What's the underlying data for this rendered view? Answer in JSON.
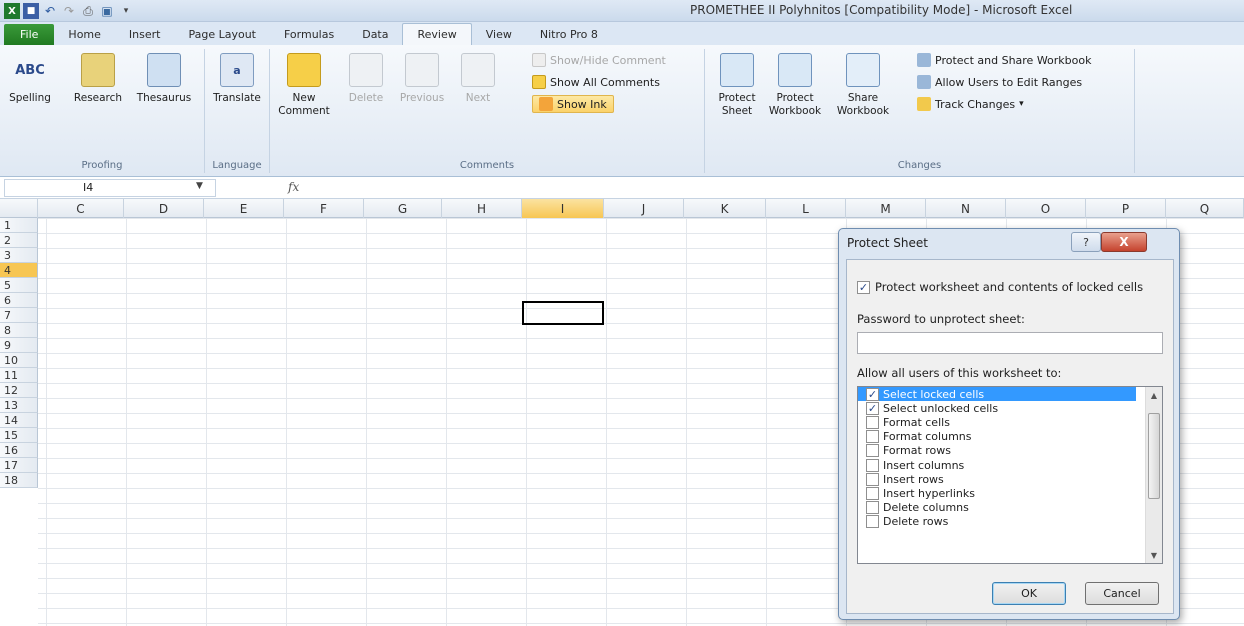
{
  "window": {
    "title": "PROMETHEE II Polyhnitos  [Compatibility Mode]  -  Microsoft Excel"
  },
  "tabs": [
    "File",
    "Home",
    "Insert",
    "Page Layout",
    "Formulas",
    "Data",
    "Review",
    "View",
    "Nitro Pro 8"
  ],
  "active_tab": "Review",
  "ribbon": {
    "proofing": {
      "label": "Proofing",
      "spelling": "Spelling",
      "research": "Research",
      "thesaurus": "Thesaurus"
    },
    "language": {
      "label": "Language",
      "translate": "Translate"
    },
    "comments": {
      "label": "Comments",
      "new_comment": "New Comment",
      "delete": "Delete",
      "previous": "Previous",
      "next": "Next",
      "show_hide": "Show/Hide Comment",
      "show_all": "Show All Comments",
      "show_ink": "Show Ink"
    },
    "changes": {
      "label": "Changes",
      "protect_sheet": "Protect Sheet",
      "protect_workbook": "Protect Workbook",
      "share_workbook": "Share Workbook",
      "protect_share": "Protect and Share Workbook",
      "allow_edit": "Allow Users to Edit Ranges",
      "track_changes": "Track Changes"
    }
  },
  "formula_bar": {
    "name_box": "I4",
    "fx": "fx",
    "value": ""
  },
  "grid": {
    "columns": [
      "C",
      "D",
      "E",
      "F",
      "G",
      "H",
      "I",
      "J",
      "K",
      "L",
      "M",
      "N",
      "O",
      "P",
      "Q"
    ],
    "rows": [
      "1",
      "2",
      "3",
      "4",
      "5",
      "6",
      "7",
      "8",
      "9",
      "10",
      "11",
      "12",
      "13",
      "14",
      "15",
      "16",
      "17",
      "18"
    ],
    "selected_column": "I",
    "selected_row": "4"
  },
  "dialog": {
    "title": "Protect Sheet",
    "help": "?",
    "close": "X",
    "protect_contents": {
      "label": "Protect worksheet and contents of locked cells",
      "checked": true
    },
    "password_label": "Password to unprotect sheet:",
    "password_value": "",
    "allow_label": "Allow all users of this worksheet to:",
    "permissions": [
      {
        "label": "Select locked cells",
        "checked": true,
        "selected": true
      },
      {
        "label": "Select unlocked cells",
        "checked": true,
        "selected": false
      },
      {
        "label": "Format cells",
        "checked": false,
        "selected": false
      },
      {
        "label": "Format columns",
        "checked": false,
        "selected": false
      },
      {
        "label": "Format rows",
        "checked": false,
        "selected": false
      },
      {
        "label": "Insert columns",
        "checked": false,
        "selected": false
      },
      {
        "label": "Insert rows",
        "checked": false,
        "selected": false
      },
      {
        "label": "Insert hyperlinks",
        "checked": false,
        "selected": false
      },
      {
        "label": "Delete columns",
        "checked": false,
        "selected": false
      },
      {
        "label": "Delete rows",
        "checked": false,
        "selected": false
      }
    ],
    "ok": "OK",
    "cancel": "Cancel"
  }
}
